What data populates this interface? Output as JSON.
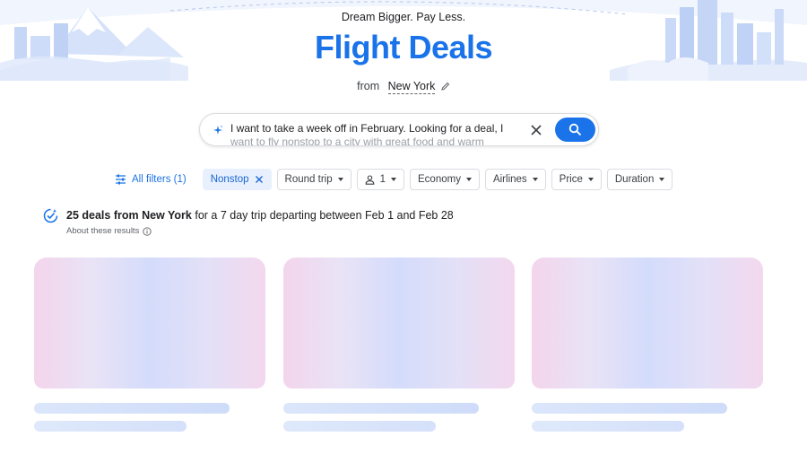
{
  "header": {
    "tagline": "Dream Bigger. Pay Less.",
    "title": "Flight Deals",
    "origin_prefix": "from",
    "origin_city": "New York"
  },
  "search": {
    "query_line1": "I want to take a week off in February. Looking for a deal, I",
    "query_line2": "want to fly nonstop to a city with great food and warm"
  },
  "filters": {
    "all_filters_label": "All filters (1)",
    "chips": [
      {
        "label": "Nonstop",
        "active": true
      },
      {
        "label": "Round trip"
      },
      {
        "label": "1"
      },
      {
        "label": "Economy"
      },
      {
        "label": "Airlines"
      },
      {
        "label": "Price"
      },
      {
        "label": "Duration"
      }
    ]
  },
  "results": {
    "count_text": "25 deals from New York",
    "rest_text": " for a 7 day trip departing between Feb 1 and Feb 28",
    "about_label": "About these results"
  },
  "colors": {
    "accent": "#1a73e8",
    "chip_active_bg": "#e8f0fe",
    "card_gradient": [
      "#f3d5ec",
      "#d4dcfb",
      "#f3d8ee"
    ]
  },
  "icons": [
    "pencil-icon",
    "sparkle-icon",
    "close-icon",
    "search-icon",
    "tune-icon",
    "person-icon",
    "verified-badge-icon",
    "info-icon"
  ]
}
